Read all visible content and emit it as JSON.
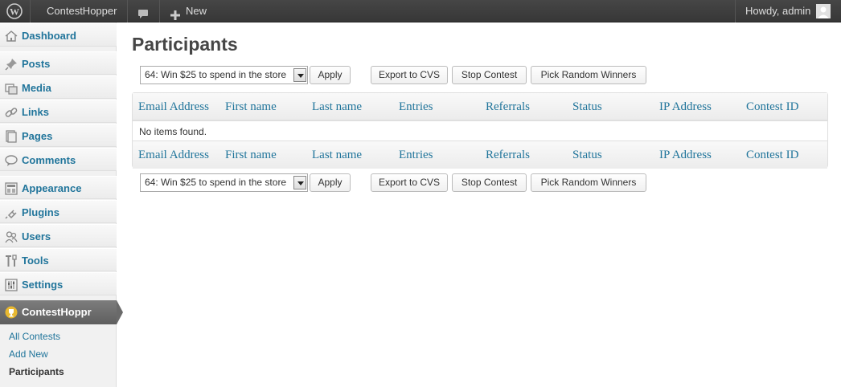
{
  "adminbar": {
    "site_name": "ContestHopper",
    "new_label": "New",
    "greeting": "Howdy, admin",
    "icons": [
      "wordpress-logo-icon",
      "comment-bubble-icon",
      "plus-icon",
      "avatar-icon"
    ]
  },
  "sidebar": {
    "items": [
      {
        "label": "Dashboard",
        "icon": "dashboard-home-icon"
      },
      {
        "label": "Posts",
        "icon": "pushpin-icon"
      },
      {
        "label": "Media",
        "icon": "media-icon"
      },
      {
        "label": "Links",
        "icon": "link-chain-icon"
      },
      {
        "label": "Pages",
        "icon": "pages-icon"
      },
      {
        "label": "Comments",
        "icon": "comments-icon"
      },
      {
        "label": "Appearance",
        "icon": "appearance-icon"
      },
      {
        "label": "Plugins",
        "icon": "plugin-icon"
      },
      {
        "label": "Users",
        "icon": "users-icon"
      },
      {
        "label": "Tools",
        "icon": "tools-icon"
      },
      {
        "label": "Settings",
        "icon": "settings-sliders-icon"
      }
    ],
    "current": {
      "label": "ContestHoppr",
      "icon": "trophy-icon"
    },
    "submenu": [
      "All Contests",
      "Add New",
      "Participants"
    ],
    "submenu_current": "Participants"
  },
  "main": {
    "title": "Participants",
    "top_actions": {
      "contest_select": "64: Win $25 to spend in the store",
      "apply": "Apply",
      "export": "Export to CVS",
      "stop": "Stop Contest",
      "pick": "Pick Random Winners"
    },
    "bottom_actions": {
      "contest_select": "64: Win $25 to spend in the store",
      "apply": "Apply",
      "export": "Export to CVS",
      "stop": "Stop Contest",
      "pick": "Pick Random Winners"
    },
    "table": {
      "columns": [
        "Email Address",
        "First name",
        "Last name",
        "Entries",
        "Referrals",
        "Status",
        "IP Address",
        "Contest ID"
      ],
      "empty_message": "No items found."
    }
  },
  "colors": {
    "link": "#21759b",
    "adminbar": "#3f3f3f",
    "current_menu": "#6d6d6d"
  }
}
